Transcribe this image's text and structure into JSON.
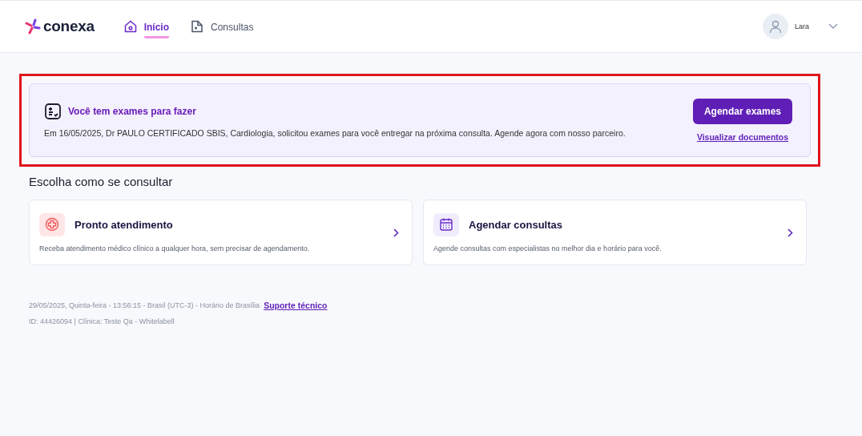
{
  "header": {
    "logo": "conexa",
    "nav": [
      {
        "label": "Início",
        "kind": "home",
        "selected": true
      },
      {
        "label": "Consultas",
        "kind": "file",
        "selected": false
      }
    ],
    "user": {
      "name": "Lara"
    }
  },
  "banner": {
    "title": "Você tem exames para fazer",
    "text": "Em 16/05/2025, Dr PAULO CERTIFICADO SBIS, Cardiologia, solicitou exames para você entregar na próxima consulta. Agende agora com nosso parceiro.",
    "button": "Agendar exames",
    "link": "Visualizar documentos"
  },
  "section_title": "Escolha como se consultar",
  "cards": [
    {
      "kind": "urgent",
      "title": "Pronto atendimento",
      "text": "Receba atendimento médico clínico a qualquer hora, sem precisar de agendamento."
    },
    {
      "kind": "schedule",
      "title": "Agendar consultas",
      "text": "Agende consultas com especialistas no melhor dia e horário para você."
    }
  ],
  "footer": {
    "datetime": "29/05/2025, Quinta-feira - 13:56:15 - Brasil (UTC-3) - Horário de Brasília",
    "support_link": "Suporte técnico",
    "info": "ID: 44426094 | Clínica: Teste Qa - Whitelabell"
  }
}
